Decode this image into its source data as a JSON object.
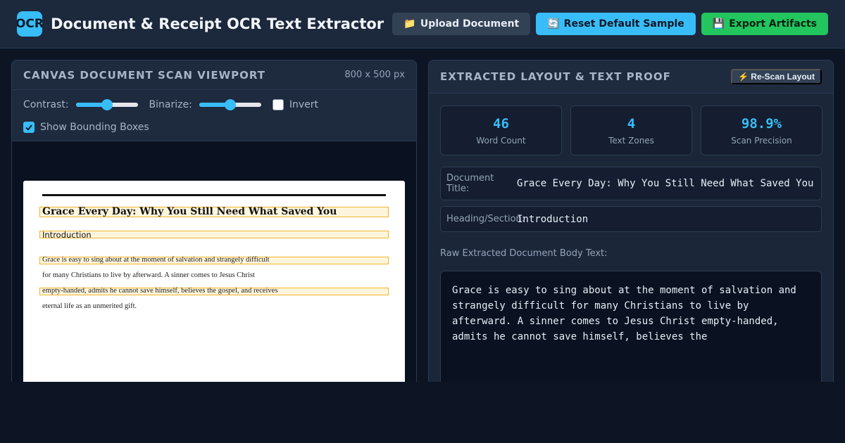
{
  "header": {
    "logo_text": "OCR",
    "title": "Document & Receipt OCR Text Extractor",
    "upload_icon": "📁",
    "upload_label": "Upload Document",
    "reset_icon": "🔄",
    "reset_label": "Reset Default Sample",
    "export_icon": "💾",
    "export_label": "Export Artifacts"
  },
  "scan_panel": {
    "title": "CANVAS DOCUMENT SCAN VIEWPORT",
    "dimensions": "800 x 500 px",
    "contrast_label": "Contrast:",
    "contrast_value": 0.5,
    "binarize_label": "Binarize:",
    "binarize_value": 0.5,
    "invert_label": "Invert",
    "invert_checked": false,
    "bbox_label": "Show Bounding Boxes",
    "bbox_checked": true,
    "document": {
      "title": "Grace Every Day: Why You Still Need What Saved You",
      "heading": "Introduction",
      "lines": [
        "Grace is easy to sing about at the moment of salvation and strangely difficult",
        "for many Christians to live by afterward. A sinner comes to Jesus Christ",
        "empty-handed, admits he cannot save himself, believes the gospel, and receives",
        "eternal life as an unmerited gift."
      ]
    }
  },
  "proof_panel": {
    "title": "EXTRACTED LAYOUT & TEXT PROOF",
    "rescan_label": "⚡ Re-Scan Layout",
    "stats": [
      {
        "value": "46",
        "label": "Word Count"
      },
      {
        "value": "4",
        "label": "Text Zones"
      },
      {
        "value": "98.9%",
        "label": "Scan Precision"
      }
    ],
    "doc_title_label": "Document Title:",
    "doc_title_value": "Grace Every Day: Why You Still Need What Saved You",
    "heading_label": "Heading/Section:",
    "heading_value": "Introduction",
    "body_label": "Raw Extracted Document Body Text:",
    "body_text": "Grace is easy to sing about at the moment of salvation and strangely difficult for many Christians to live by afterward. A sinner comes to Jesus Christ empty-handed, admits he cannot save himself, believes the"
  },
  "colors": {
    "accent": "#38bdf8",
    "success": "#22c55e",
    "highlight": "#f0b429"
  }
}
